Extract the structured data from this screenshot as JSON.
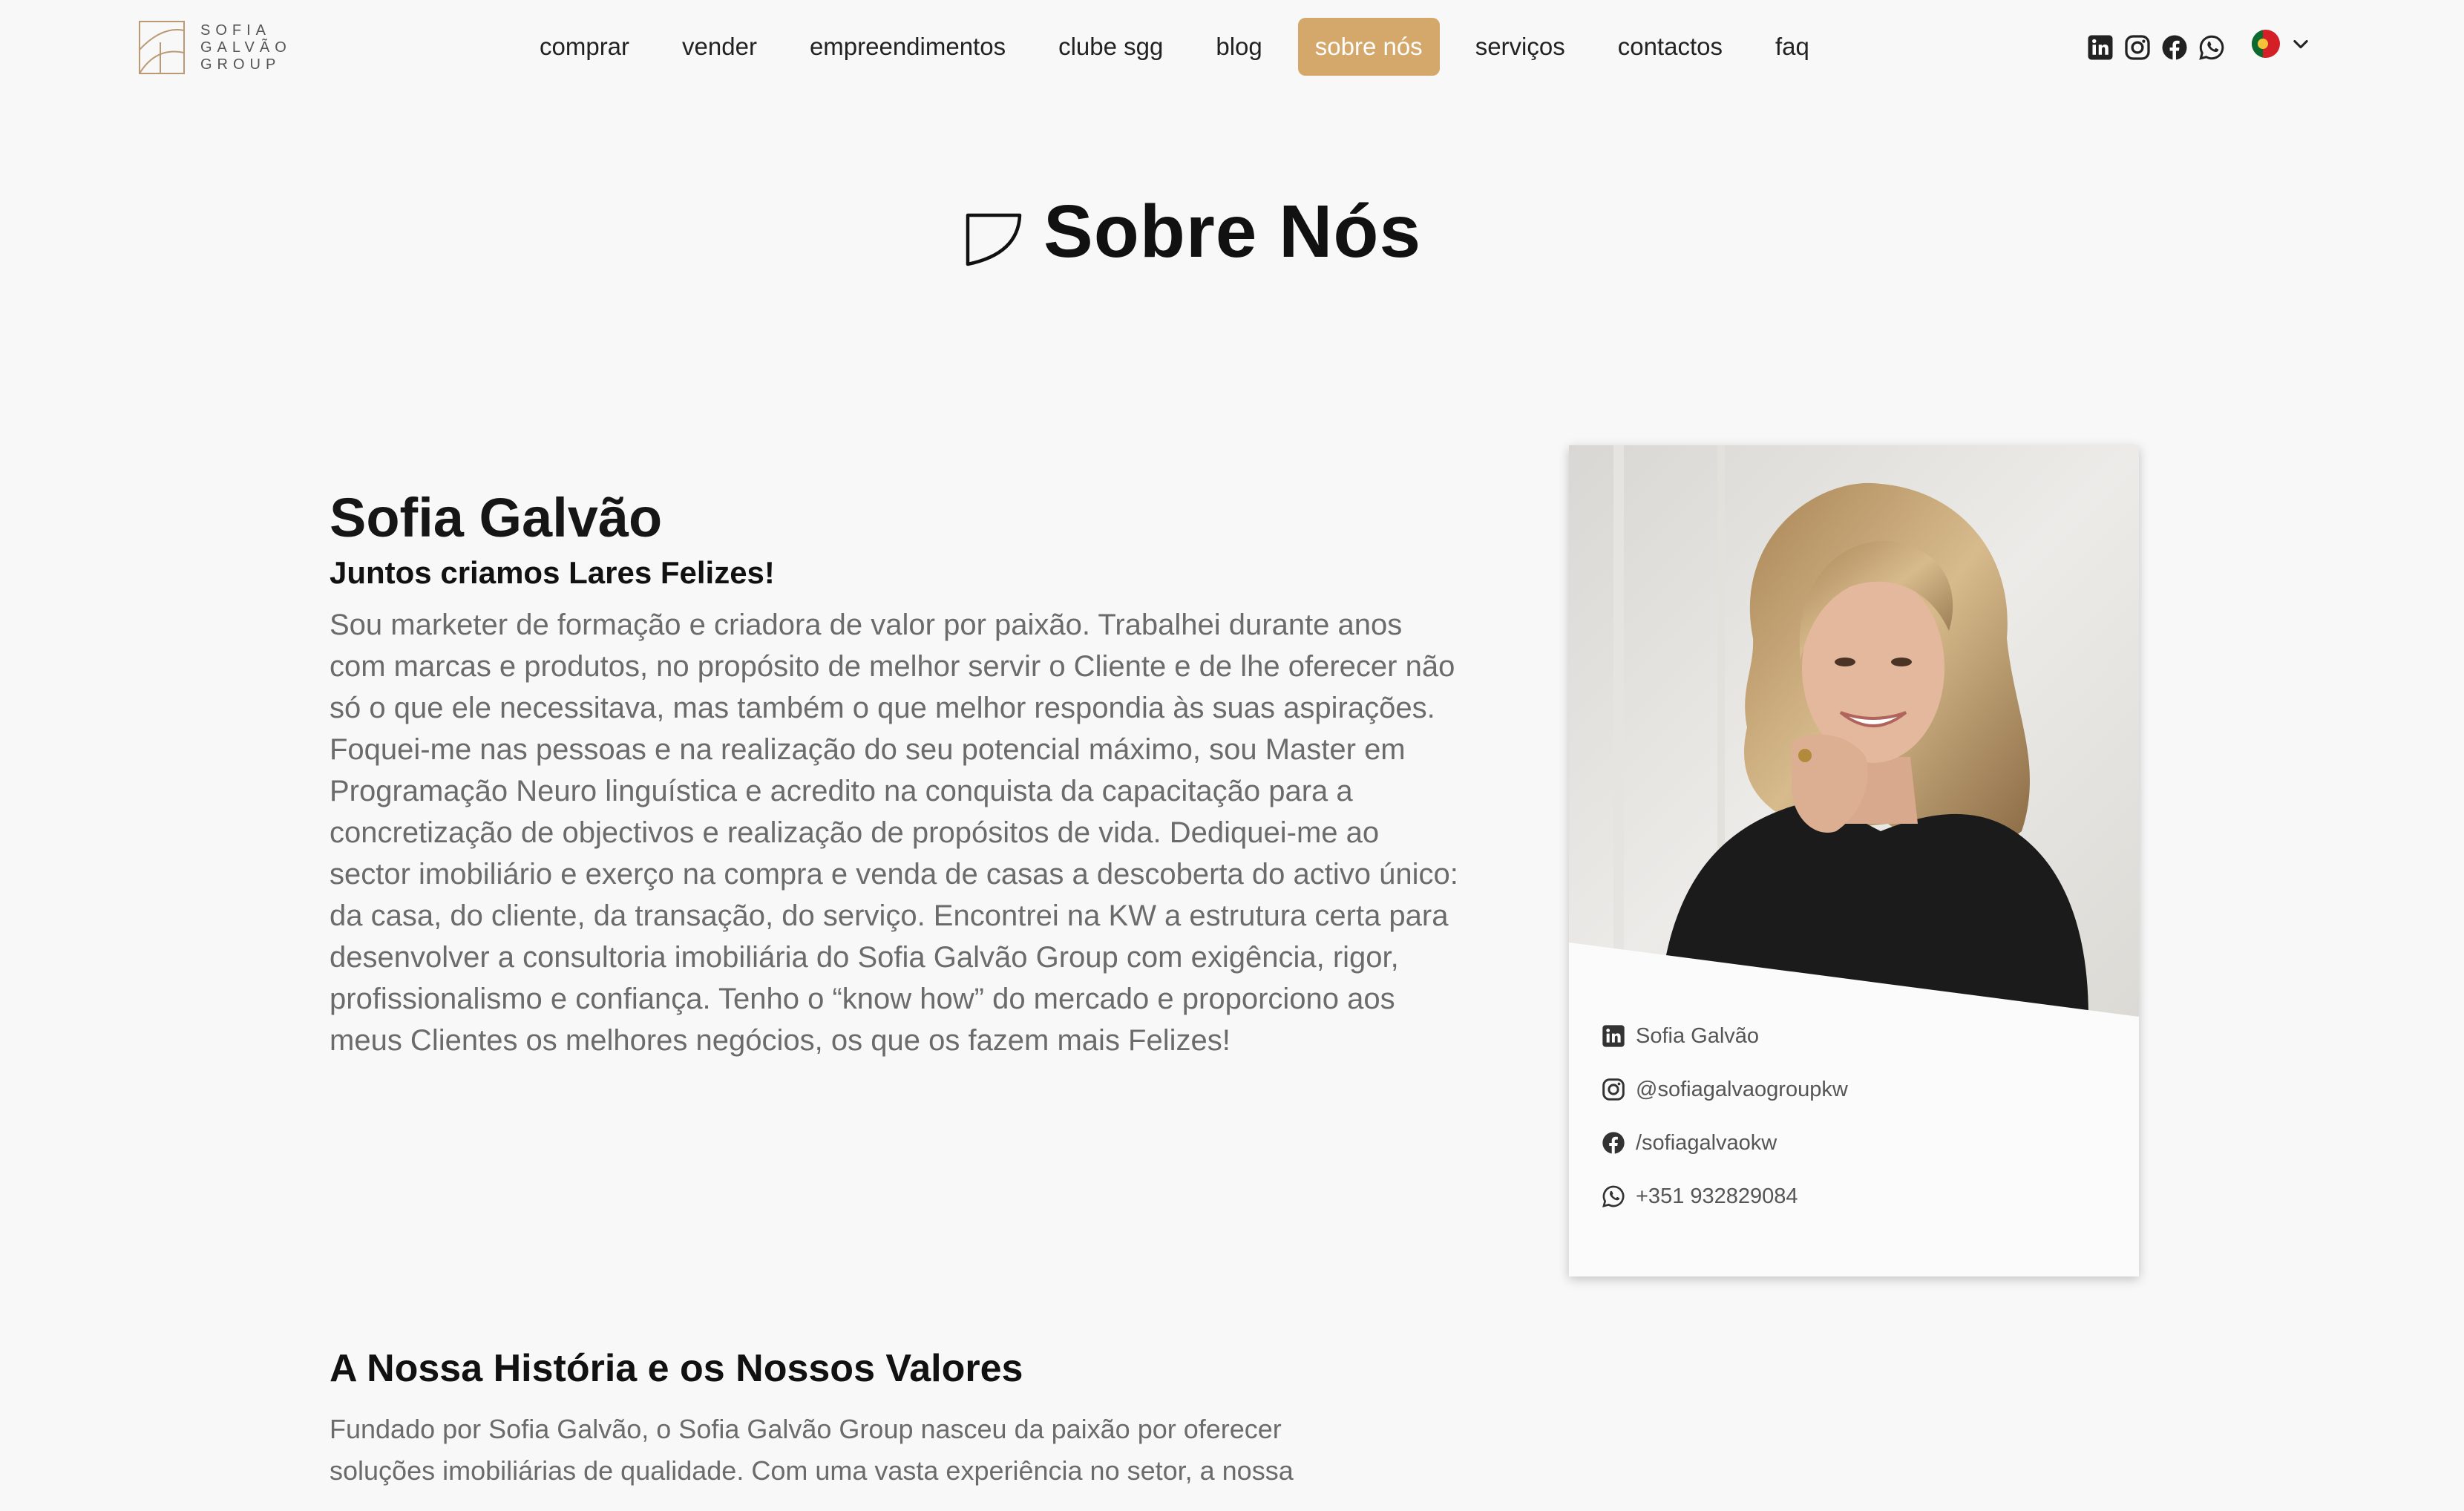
{
  "brand": {
    "logo_lines": [
      "SOFIA",
      "GALVÃO",
      "GROUP"
    ],
    "accent_color": "#d4a76a"
  },
  "nav": {
    "items": [
      {
        "label": "comprar",
        "active": false
      },
      {
        "label": "vender",
        "active": false
      },
      {
        "label": "empreendimentos",
        "active": false
      },
      {
        "label": "clube sgg",
        "active": false
      },
      {
        "label": "blog",
        "active": false
      },
      {
        "label": "sobre nós",
        "active": true
      },
      {
        "label": "serviços",
        "active": false
      },
      {
        "label": "contactos",
        "active": false
      },
      {
        "label": "faq",
        "active": false
      }
    ]
  },
  "header_social_icons": [
    "linkedin-icon",
    "instagram-icon",
    "facebook-icon",
    "whatsapp-icon"
  ],
  "language": {
    "selected_flag": "portugal-flag-icon"
  },
  "page": {
    "title": "Sobre Nós"
  },
  "bio": {
    "name": "Sofia Galvão",
    "tagline": "Juntos criamos Lares Felizes!",
    "text": "Sou marketer de formação e criadora de valor por paixão. Trabalhei durante anos com marcas e produtos, no propósito de melhor servir o Cliente e de lhe oferecer não só o que ele necessitava, mas também o que melhor respondia às suas aspirações. Foquei-me nas pessoas e na realização do seu potencial máximo, sou Master em Programação Neuro linguística e acredito na conquista da capacitação para a concretização de objectivos e realização de propósitos de vida. Dediquei-me ao sector imobiliário e exerço na compra e venda de casas a descoberta do activo único: da casa, do cliente, da transação, do serviço. Encontrei na KW a estrutura certa para desenvolver a consultoria imobiliária do Sofia Galvão Group com exigência, rigor, profissionalismo e confiança. Tenho o “know how” do mercado e proporciono aos meus Clientes os melhores negócios, os que os fazem mais Felizes!"
  },
  "card": {
    "contacts": [
      {
        "icon": "linkedin-icon",
        "label": "Sofia Galvão"
      },
      {
        "icon": "instagram-icon",
        "label": "@sofiagalvaogroupkw"
      },
      {
        "icon": "facebook-icon",
        "label": "/sofiagalvaokw"
      },
      {
        "icon": "whatsapp-icon",
        "label": "+351 932829084"
      }
    ]
  },
  "history": {
    "title": "A Nossa História e os Nossos Valores",
    "text": "Fundado por Sofia Galvão, o Sofia Galvão Group nasceu da paixão por oferecer soluções imobiliárias de qualidade. Com uma vasta experiência no setor, a nossa"
  }
}
